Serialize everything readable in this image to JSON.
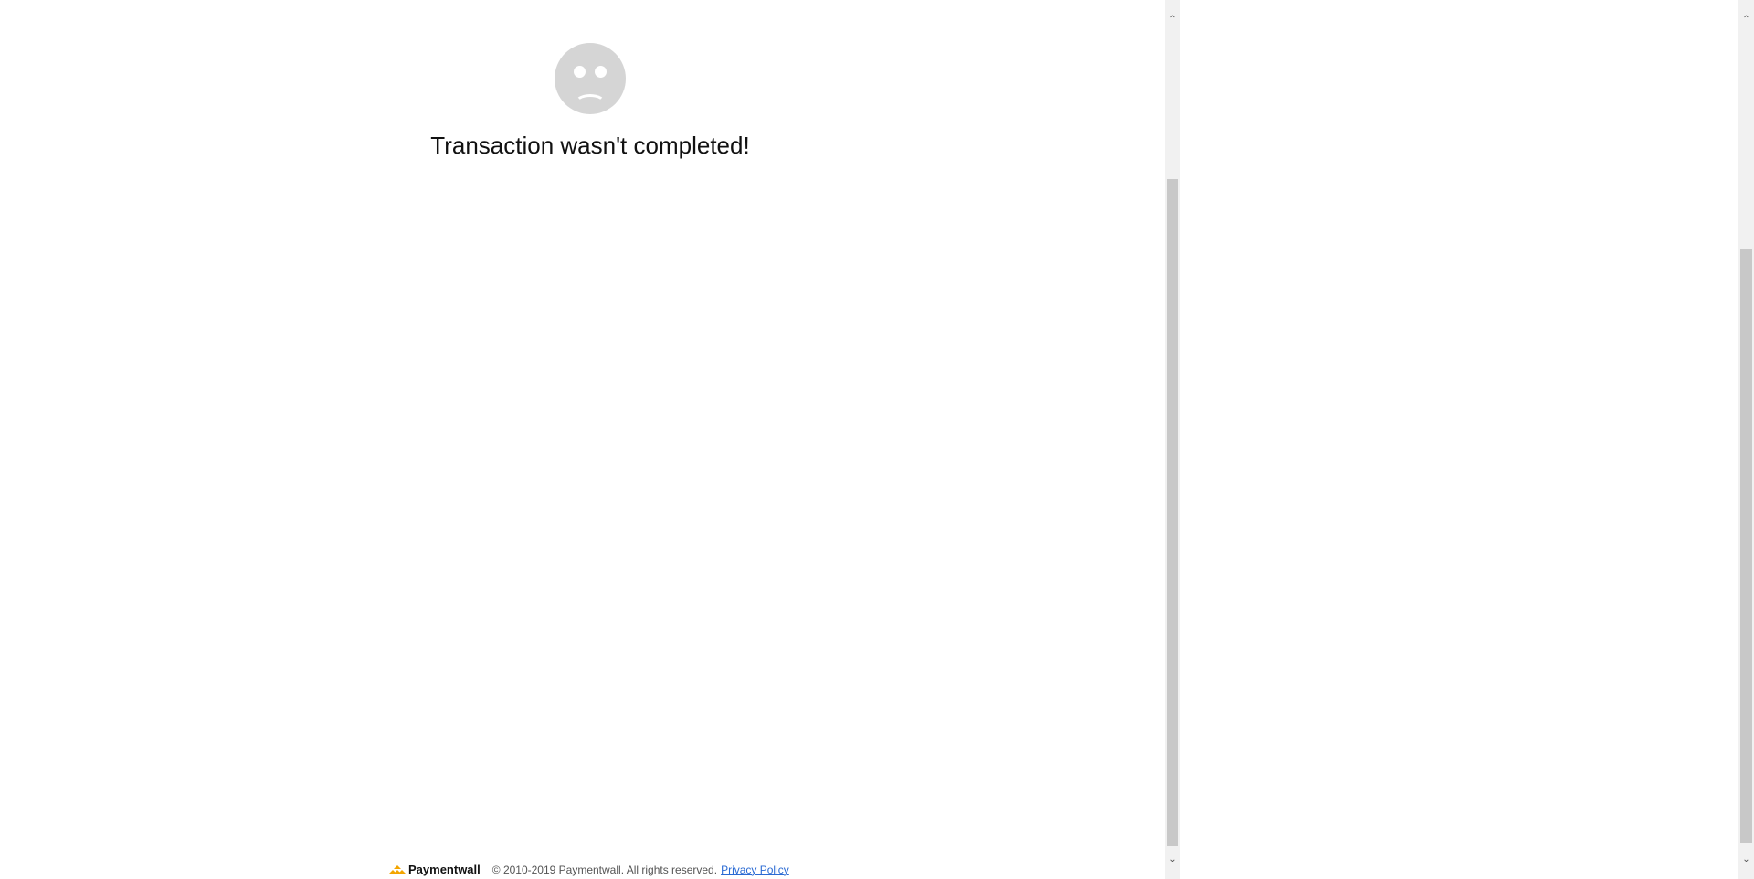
{
  "error": {
    "title": "Transaction wasn't completed!",
    "icon": "sad-face-icon"
  },
  "footer": {
    "brand": "Paymentwall",
    "copyright": "© 2010-2019 Paymentwall. All rights reserved.",
    "privacy_link": "Privacy Policy"
  },
  "colors": {
    "face": "#d5d5d5",
    "link": "#2a6ad3",
    "brand_logo": "#f3a500"
  }
}
